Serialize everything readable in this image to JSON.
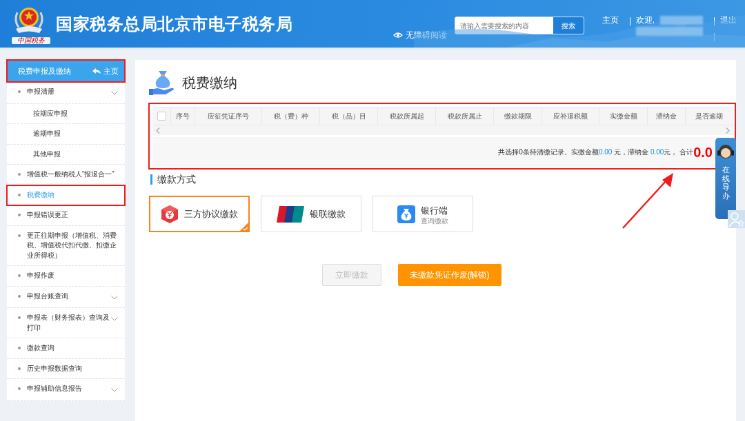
{
  "header": {
    "logo_caption": "中国税务",
    "title": "国家税务总局北京市电子税务局",
    "accessibility": "无障碍阅读",
    "search": {
      "placeholder": "请输入需要搜索的内容",
      "button": "搜索"
    },
    "nav": {
      "home": "主页",
      "welcome": "欢迎,",
      "logout": "退出"
    }
  },
  "sidebar": {
    "title": "税费申报及缴纳",
    "home": "主页",
    "items": [
      {
        "label": "申报清册",
        "selected": false,
        "submenu": true,
        "children": [
          {
            "label": "按期应申报",
            "selected": false
          },
          {
            "label": "逾期申报",
            "selected": false
          },
          {
            "label": "其他申报",
            "selected": false
          }
        ]
      },
      {
        "label": "增值税一般纳税人“报退合一”",
        "selected": false,
        "submenu": false
      },
      {
        "label": "税费缴纳",
        "selected": true,
        "submenu": false
      },
      {
        "label": "申报错误更正",
        "selected": false,
        "submenu": false
      },
      {
        "label": "更正往期申报（增值税、消费税、增值税代扣代缴、扣缴企业所得税）",
        "selected": false,
        "submenu": false
      },
      {
        "label": "申报作废",
        "selected": false,
        "submenu": false
      },
      {
        "label": "申报台账查询",
        "selected": false,
        "submenu": true
      },
      {
        "label": "申报表（财务报表）查询及打印",
        "selected": false,
        "submenu": true
      },
      {
        "label": "缴款查询",
        "selected": false,
        "submenu": false
      },
      {
        "label": "历史申报数据查询",
        "selected": false,
        "submenu": false
      },
      {
        "label": "申报辅助信息报告",
        "selected": false,
        "submenu": true
      }
    ]
  },
  "page": {
    "title": "税费缴纳",
    "table": {
      "select_all": {
        "checked": false
      },
      "columns": [
        "序号",
        "应征凭证序号",
        "税（费）种",
        "税（品）目",
        "税款所属起",
        "税款所属止",
        "缴款期限",
        "应补退税额",
        "实缴金额",
        "滞纳金",
        "是否逾期"
      ]
    },
    "summary": {
      "prefix": "共选择0条待清缴记录。实缴金额",
      "paid": "0.00",
      "middle": " 元，滞纳金 ",
      "late_fee": "0.00",
      "suffix": "元， 合计",
      "total": "0.0"
    },
    "payment_section": "缴款方式",
    "payment_methods": [
      {
        "kind": "three_party",
        "label": "三方协议缴款",
        "selected": true
      },
      {
        "kind": "unionpay",
        "label": "银联缴款",
        "selected": false
      },
      {
        "kind": "bank",
        "label": "银行端",
        "sublabel": "查询缴款",
        "selected": false
      }
    ],
    "buttons": [
      {
        "label": "立即缴款",
        "disabled": true
      },
      {
        "label": "未缴款凭证作废(解锁)",
        "disabled": false
      }
    ]
  },
  "guide": {
    "label": "在线导办"
  }
}
